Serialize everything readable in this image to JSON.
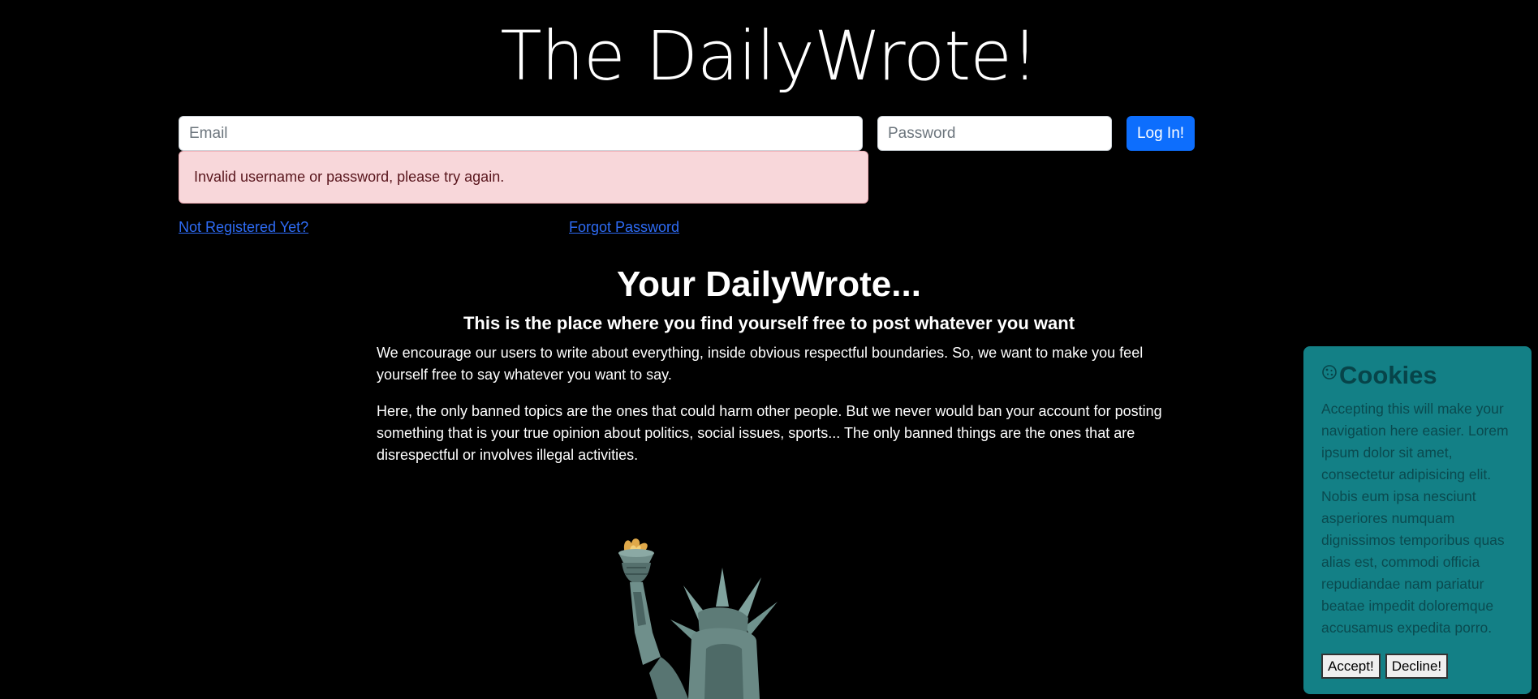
{
  "header": {
    "title": "The DailyWrote!"
  },
  "login": {
    "email_placeholder": "Email",
    "email_value": "",
    "password_placeholder": "Password",
    "password_value": "",
    "submit_label": "Log In!",
    "error_message": "Invalid username or password, please try again.",
    "register_link": "Not Registered Yet?",
    "forgot_link": "Forgot Password"
  },
  "main": {
    "headline": "Your DailyWrote...",
    "subheadline": "This is the place where you find yourself free to post whatever you want",
    "paragraphs": [
      "We encourage our users to write about everything, inside obvious respectful boundaries. So, we want to make you feel yourself free to say whatever you want to say.",
      "Here, the only banned topics are the ones that could harm other people. But we never would ban your account for posting something that is your true opinion about politics, social issues, sports... The only banned things are the ones that are disrespectful or involves illegal activities."
    ],
    "image": "statue-of-liberty"
  },
  "cookies": {
    "icon": "cookie-icon",
    "title": "Cookies",
    "text": "Accepting this will make your navigation here easier. Lorem ipsum dolor sit amet, consectetur adipisicing elit. Nobis eum ipsa nesciunt asperiores numquam dignissimos temporibus quas alias est, commodi officia repudiandae nam pariatur beatae impedit doloremque accusamus expedita porro.",
    "accept_label": "Accept!",
    "decline_label": "Decline!"
  },
  "colors": {
    "background": "#000000",
    "primary": "#0d6efd",
    "alert_bg": "#f8d7da",
    "cookie_bg": "#138086",
    "link": "#2e6cf6"
  }
}
